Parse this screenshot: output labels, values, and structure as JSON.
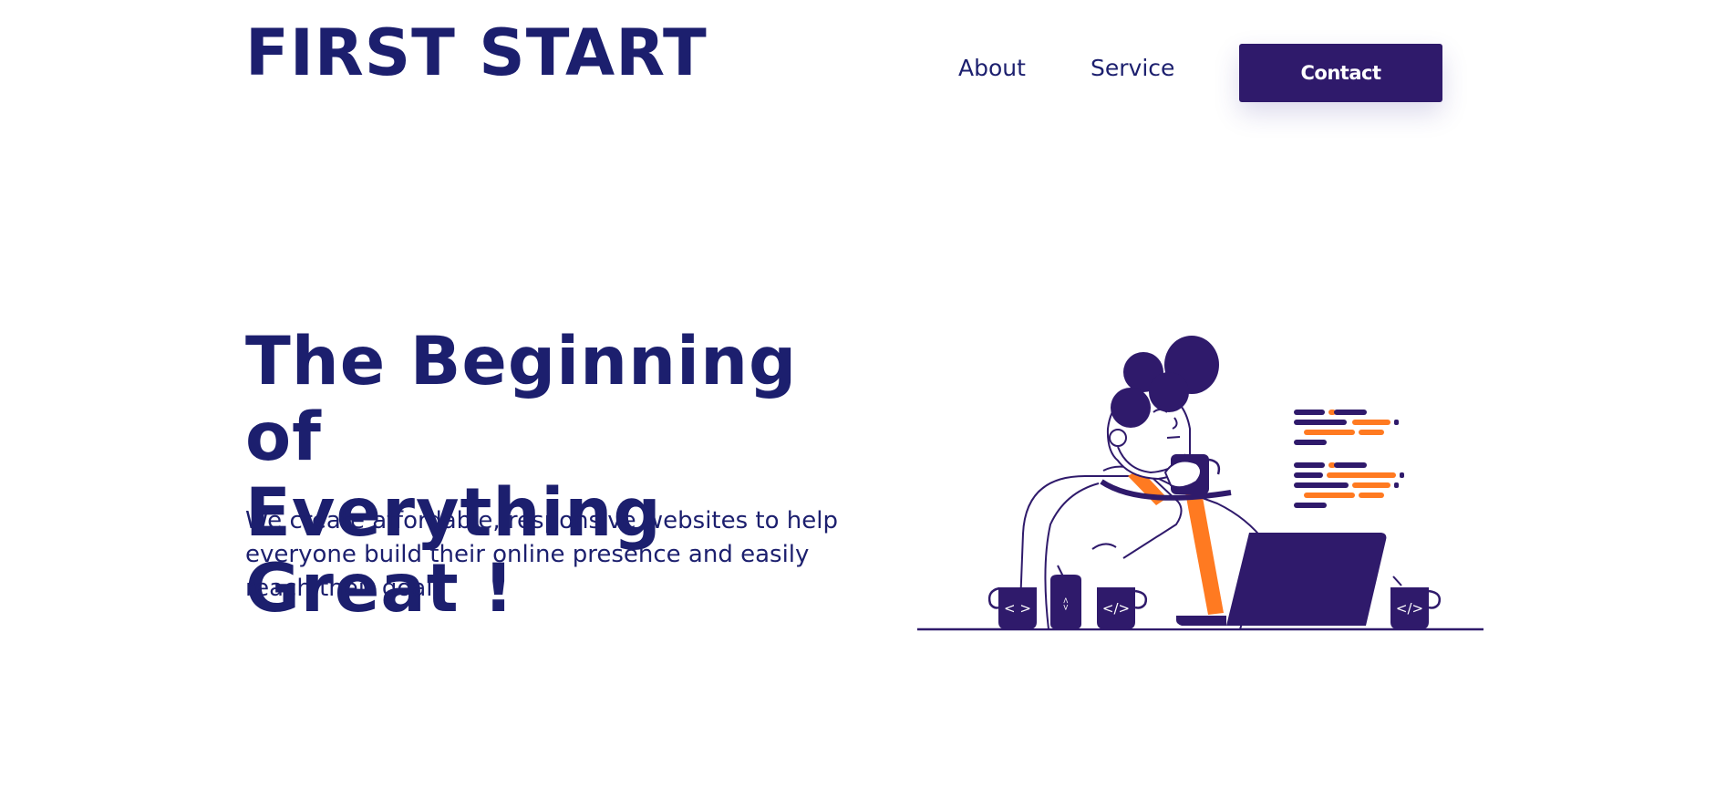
{
  "header": {
    "logo": "FIRST START",
    "nav": {
      "about": "About",
      "service": "Service",
      "contact": "Contact"
    }
  },
  "hero": {
    "title_line1": "The Beginning of",
    "title_line2": "Everything Great !",
    "subtitle": "We create affordable, responsive websites to help everyone build their online presence and easily reach their goals"
  },
  "illustration": {
    "mug_left_glyph": "< >",
    "can_glyph": "<>",
    "mug_middle_glyph": "</>",
    "mug_right_glyph": "</>"
  },
  "colors": {
    "primary": "#1c1f6e",
    "button": "#2f1a6b",
    "accent": "#ff7a21",
    "background": "#ffffff"
  }
}
